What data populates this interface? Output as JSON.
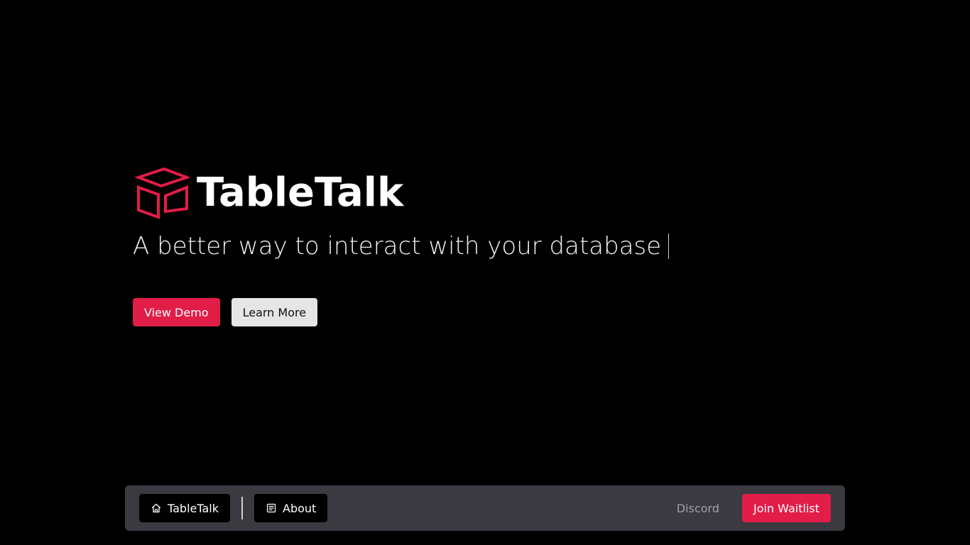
{
  "colors": {
    "background": "#000000",
    "accent": "#e11d48",
    "navbar_bg": "#3a3a40",
    "secondary_button_bg": "#e5e5e5",
    "muted_link": "#a0a0a8"
  },
  "hero": {
    "brand_name": "TableTalk",
    "logo_icon": "cube-outline-icon",
    "tagline": "A better way to interact with your database",
    "buttons": {
      "view_demo": "View Demo",
      "learn_more": "Learn More"
    }
  },
  "navbar": {
    "home_label": "TableTalk",
    "home_icon": "home-icon",
    "about_label": "About",
    "about_icon": "document-icon",
    "discord_label": "Discord",
    "join_waitlist_label": "Join Waitlist"
  }
}
